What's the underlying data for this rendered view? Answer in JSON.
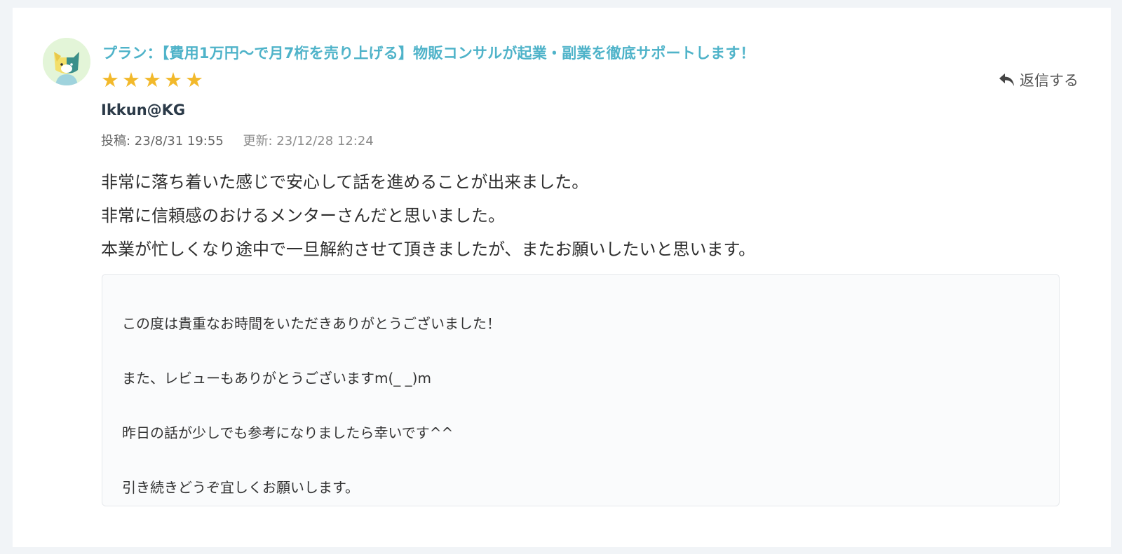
{
  "review": {
    "plan_title": "プラン：【費用1万円〜で月7桁を売り上げる】物販コンサルが起業・副業を徹底サポートします！",
    "rating": 5,
    "stars": [
      "★",
      "★",
      "★",
      "★",
      "★"
    ],
    "reply_label": "返信する",
    "username": "Ikkun@KG",
    "posted": "投稿: 23/8/31 19:55",
    "updated": "更新: 23/12/28 12:24",
    "body_lines": [
      "非常に落ち着いた感じで安心して話を進めることが出来ました。",
      "非常に信頼感のおけるメンターさんだと思いました。",
      "本業が忙しくなり途中で一旦解約させて頂きましたが、またお願いしたいと思います。"
    ]
  },
  "seller_reply": {
    "lines": [
      "この度は貴重なお時間をいただきありがとうございました！",
      "また、レビューもありがとうございますm(_ _)m",
      "昨日の話が少しでも参考になりましたら幸いです^^",
      "引き続きどうぞ宜しくお願いします。"
    ]
  },
  "colors": {
    "accent": "#4fb3c9",
    "star": "#f2b92b",
    "page_bg": "#f1f4f7"
  },
  "icons": {
    "avatar": "cat-avatar-icon",
    "reply": "reply-arrow-icon",
    "star": "star-icon"
  }
}
